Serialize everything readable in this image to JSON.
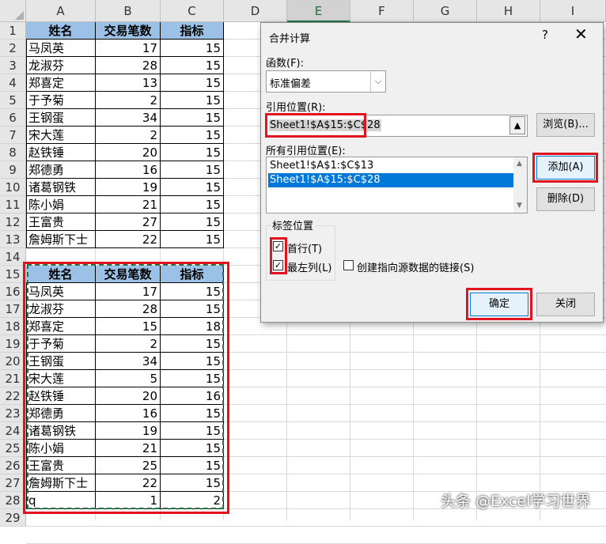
{
  "columns": [
    "A",
    "B",
    "C",
    "D",
    "E",
    "F",
    "G",
    "H",
    "I"
  ],
  "selected_column": "E",
  "rows": [
    "1",
    "2",
    "3",
    "4",
    "5",
    "6",
    "7",
    "8",
    "9",
    "10",
    "11",
    "12",
    "13",
    "14",
    "15",
    "16",
    "17",
    "18",
    "19",
    "20",
    "21",
    "22",
    "23",
    "24",
    "25",
    "26",
    "27",
    "28",
    "29"
  ],
  "table1": {
    "headers": [
      "姓名",
      "交易笔数",
      "指标"
    ],
    "rows": [
      [
        "马凤英",
        "17",
        "15"
      ],
      [
        "龙淑芬",
        "28",
        "15"
      ],
      [
        "郑喜定",
        "13",
        "15"
      ],
      [
        "于予菊",
        "2",
        "15"
      ],
      [
        "王钢蛋",
        "34",
        "15"
      ],
      [
        "宋大莲",
        "2",
        "15"
      ],
      [
        "赵铁锤",
        "20",
        "15"
      ],
      [
        "郑德勇",
        "16",
        "15"
      ],
      [
        "诸葛钢铁",
        "19",
        "15"
      ],
      [
        "陈小娟",
        "21",
        "15"
      ],
      [
        "王富贵",
        "27",
        "15"
      ],
      [
        "詹姆斯下士",
        "22",
        "15"
      ]
    ]
  },
  "table2": {
    "headers": [
      "姓名",
      "交易笔数",
      "指标"
    ],
    "rows": [
      [
        "马凤英",
        "17",
        "15"
      ],
      [
        "龙淑芬",
        "28",
        "15"
      ],
      [
        "郑喜定",
        "15",
        "18"
      ],
      [
        "于予菊",
        "2",
        "15"
      ],
      [
        "王钢蛋",
        "34",
        "15"
      ],
      [
        "宋大莲",
        "5",
        "15"
      ],
      [
        "赵铁锤",
        "20",
        "16"
      ],
      [
        "郑德勇",
        "16",
        "15"
      ],
      [
        "诸葛钢铁",
        "19",
        "15"
      ],
      [
        "陈小娟",
        "21",
        "15"
      ],
      [
        "王富贵",
        "25",
        "15"
      ],
      [
        "詹姆斯下士",
        "22",
        "15"
      ],
      [
        "q",
        "1",
        "2"
      ]
    ]
  },
  "dialog": {
    "title": "合并计算",
    "help": "?",
    "close": "✕",
    "function_label": "函数(F):",
    "function_value": "标准偏差",
    "reference_label": "引用位置(R):",
    "reference_value": "Sheet1!$A$15:$C$28",
    "browse_button": "浏览(B)...",
    "all_references_label": "所有引用位置(E):",
    "all_references": [
      "Sheet1!$A$1:$C$13",
      "Sheet1!$A$15:$C$28"
    ],
    "selected_reference_index": 1,
    "add_button": "添加(A)",
    "delete_button": "删除(D)",
    "label_group": "标签位置",
    "top_row_label": "首行(T)",
    "top_row_checked": true,
    "left_column_label": "最左列(L)",
    "left_column_checked": true,
    "create_links_label": "创建指向源数据的链接(S)",
    "create_links_checked": false,
    "ok_button": "确定",
    "close_button": "关闭"
  },
  "watermark": "头条 @Excel学习世界",
  "colors": {
    "header_fill": "#9bc2e6",
    "highlight": "#e0141e",
    "selection": "#0078d7",
    "marching_ants": "#217346"
  }
}
